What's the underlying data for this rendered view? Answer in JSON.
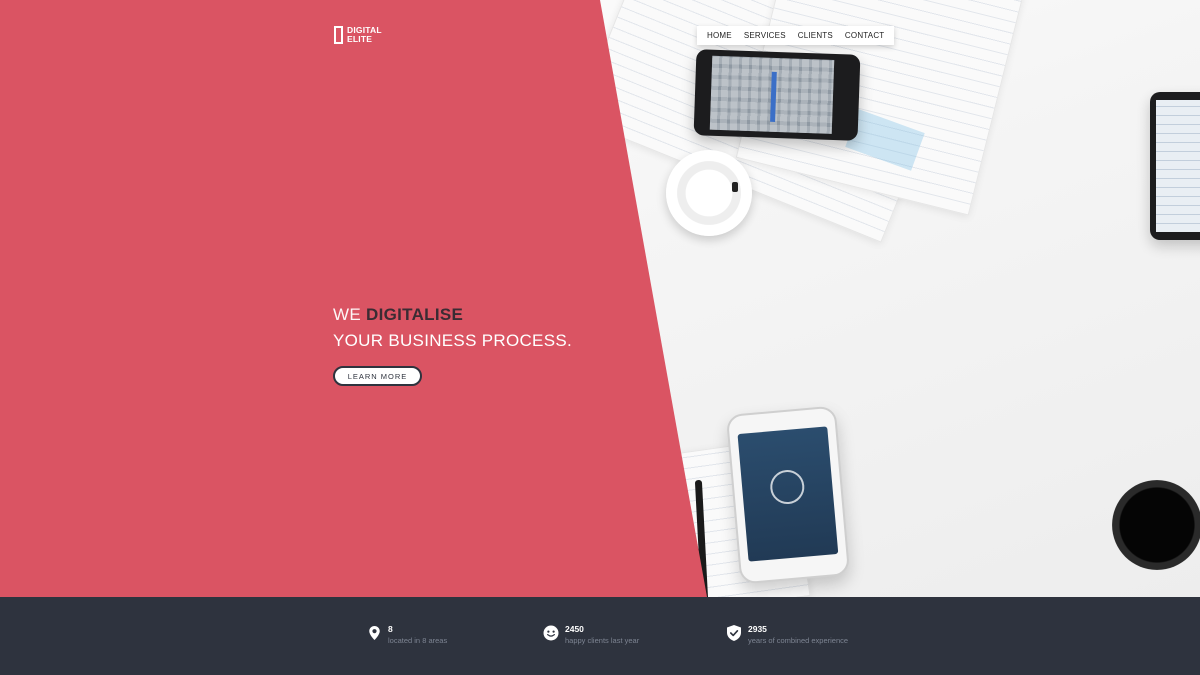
{
  "brand": {
    "line1": "DIGITAL",
    "line2": "ELITE"
  },
  "nav": {
    "items": [
      "HOME",
      "SERVICES",
      "CLIENTS",
      "CONTACT"
    ]
  },
  "hero": {
    "prefix": "WE",
    "highlight": "DIGITALISE",
    "line2": "YOUR BUSINESS PROCESS.",
    "cta_label": "LEARN MORE"
  },
  "stats": [
    {
      "icon": "map-pin-icon",
      "value": "8",
      "label": "located in 8 areas"
    },
    {
      "icon": "smiley-icon",
      "value": "2450",
      "label": "happy clients last year"
    },
    {
      "icon": "shield-check-icon",
      "value": "2935",
      "label": "years of combined experience"
    }
  ],
  "colors": {
    "accent": "#da5463",
    "dark": "#2e333e",
    "headline_strong": "#3a2c33"
  }
}
